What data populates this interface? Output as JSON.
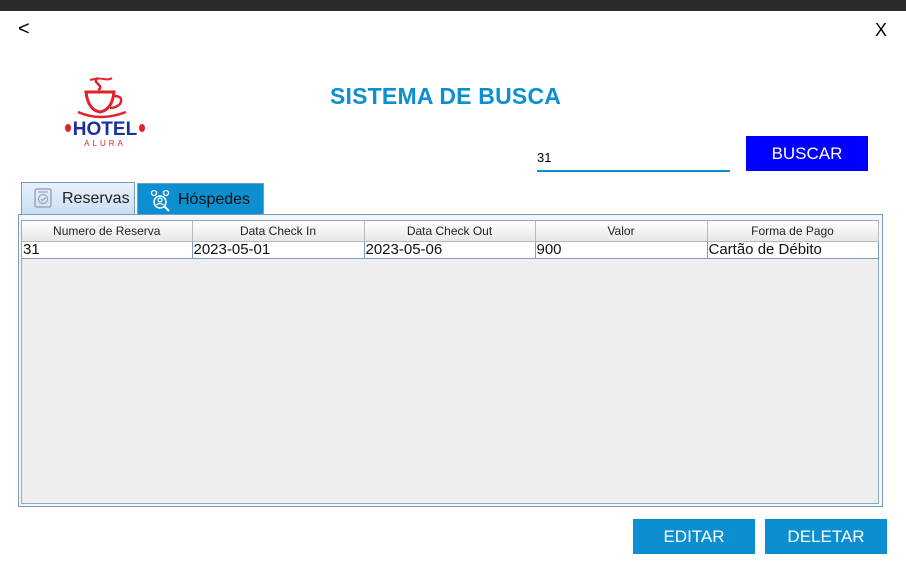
{
  "window": {
    "back_label": "<",
    "close_label": "X"
  },
  "logo": {
    "text": "HOTEL",
    "subtext": "ALURA",
    "icon": "hotel-logo-cup-icon",
    "color": "#e1222a"
  },
  "header": {
    "title": "SISTEMA DE BUSCA"
  },
  "search": {
    "value": "31",
    "button_label": "BUSCAR"
  },
  "tabs": [
    {
      "label": "Reservas",
      "icon": "reservation-document-icon",
      "selected": true
    },
    {
      "label": "Hóspedes",
      "icon": "guests-search-icon",
      "selected": false
    }
  ],
  "table": {
    "columns": [
      "Numero de Reserva",
      "Data Check In",
      "Data Check Out",
      "Valor",
      "Forma de Pago"
    ],
    "rows": [
      [
        "31",
        "2023-05-01",
        "2023-05-06",
        "900",
        "Cartão de Débito"
      ]
    ]
  },
  "actions": {
    "edit_label": "EDITAR",
    "delete_label": "DELETAR"
  },
  "colors": {
    "accent": "#0b8fd0",
    "search_button": "#0000ff",
    "logo_red": "#e1222a"
  }
}
